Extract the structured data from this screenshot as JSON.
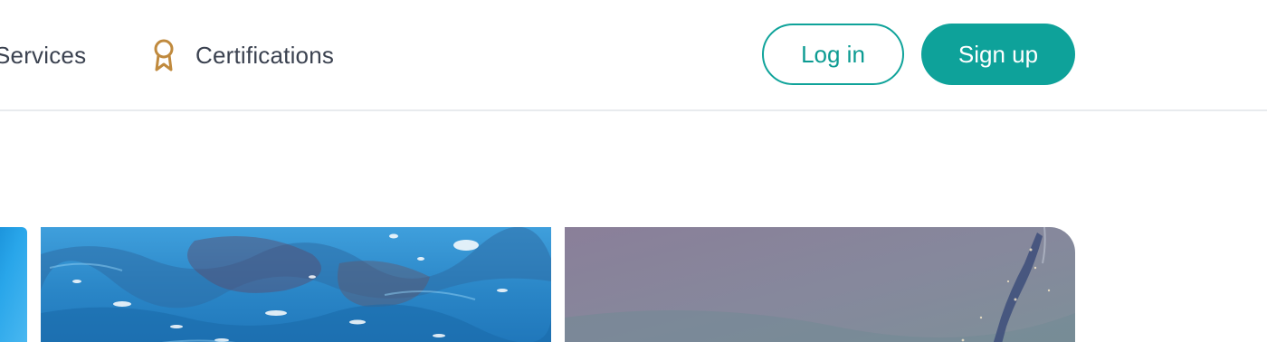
{
  "nav": {
    "services_label": "Services",
    "certifications_label": "Certifications",
    "certifications_icon": "award-ribbon-icon"
  },
  "auth": {
    "login_label": "Log in",
    "signup_label": "Sign up"
  },
  "colors": {
    "brand": "#0ea29a",
    "icon_accent": "#c08a3e",
    "nav_text": "#3b4250"
  },
  "gallery": {
    "images": [
      {
        "description_icon": "underwater-photo"
      },
      {
        "description_icon": "water-surface-photo"
      },
      {
        "description_icon": "diver-underwater-photo"
      }
    ]
  }
}
